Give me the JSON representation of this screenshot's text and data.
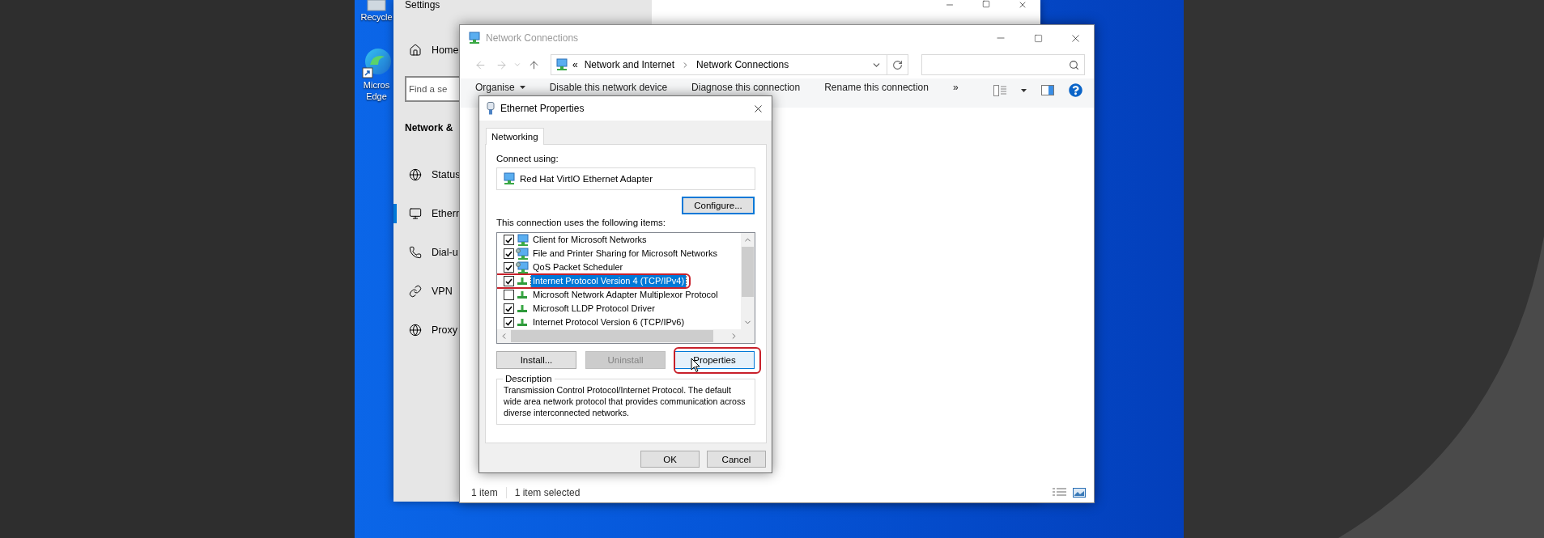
{
  "desktop": {
    "icons": [
      {
        "label": "Recycle",
        "kind": "recycle_bin"
      },
      {
        "label": "Micros Edge",
        "kind": "browser"
      }
    ]
  },
  "settings": {
    "title": "Settings",
    "home": "Home",
    "search": {
      "placeholder": "Find a se"
    },
    "section_title": "Network &",
    "nav": [
      {
        "label": "Status",
        "kind": "status",
        "selected": false
      },
      {
        "label": "Ethern",
        "kind": "ethernet",
        "selected": true
      },
      {
        "label": "Dial-u",
        "kind": "dialup",
        "selected": false
      },
      {
        "label": "VPN",
        "kind": "vpn",
        "selected": false
      },
      {
        "label": "Proxy",
        "kind": "proxy",
        "selected": false
      }
    ]
  },
  "network_connections": {
    "title": "Network Connections",
    "address": {
      "prefix": "«",
      "path": [
        "Network and Internet",
        "Network Connections"
      ]
    },
    "toolbar": {
      "items": [
        {
          "label": "Organise",
          "kind": "menu"
        },
        {
          "label": "Disable this network device",
          "kind": "command"
        },
        {
          "label": "Diagnose this connection",
          "kind": "command"
        },
        {
          "label": "Rename this connection",
          "kind": "command"
        }
      ],
      "overflow": "»"
    },
    "status_bar": [
      "1 item",
      "1 item selected"
    ]
  },
  "dialog": {
    "title": "Ethernet Properties",
    "tabs": [
      {
        "label": "Networking",
        "selected": true
      }
    ],
    "connect_using_label": "Connect using:",
    "adapter": "Red Hat VirtIO Ethernet Adapter",
    "configure_button": {
      "label": "Configure...",
      "focused": true
    },
    "items_label": "This connection uses the following items:",
    "items": [
      {
        "label": "Client for Microsoft Networks",
        "kind": "client",
        "checked": true,
        "selected": false,
        "highlighted": false
      },
      {
        "label": "File and Printer Sharing for Microsoft Networks",
        "kind": "service",
        "checked": true,
        "selected": false,
        "highlighted": false
      },
      {
        "label": "QoS Packet Scheduler",
        "kind": "service",
        "checked": true,
        "selected": false,
        "highlighted": false
      },
      {
        "label": "Internet Protocol Version 4 (TCP/IPv4)",
        "kind": "protocol",
        "checked": true,
        "selected": true,
        "highlighted": true
      },
      {
        "label": "Microsoft Network Adapter Multiplexor Protocol",
        "kind": "protocol",
        "checked": false,
        "selected": false,
        "highlighted": false
      },
      {
        "label": "Microsoft LLDP Protocol Driver",
        "kind": "protocol",
        "checked": true,
        "selected": false,
        "highlighted": false
      },
      {
        "label": "Internet Protocol Version 6 (TCP/IPv6)",
        "kind": "protocol",
        "checked": true,
        "selected": false,
        "highlighted": false
      }
    ],
    "buttons": [
      {
        "label": "Install...",
        "disabled": false,
        "hovered": false,
        "highlighted": false
      },
      {
        "label": "Uninstall",
        "disabled": true,
        "hovered": false,
        "highlighted": false
      },
      {
        "label": "Properties",
        "disabled": false,
        "hovered": true,
        "highlighted": true
      }
    ],
    "description": {
      "legend": "Description",
      "text": "Transmission Control Protocol/Internet Protocol. The default wide area network protocol that provides communication across diverse interconnected networks."
    },
    "footer_buttons": [
      {
        "label": "OK"
      },
      {
        "label": "Cancel"
      }
    ]
  }
}
